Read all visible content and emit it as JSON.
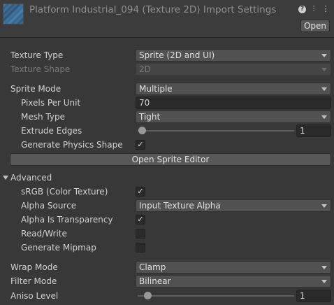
{
  "header": {
    "title": "Platform Industrial_094 (Texture 2D) Import Settings",
    "open_label": "Open",
    "help_icon": "?",
    "settings_icon": "⫶",
    "menu_icon": "⋮"
  },
  "settings": {
    "texture_type": {
      "label": "Texture Type",
      "value": "Sprite (2D and UI)"
    },
    "texture_shape": {
      "label": "Texture Shape",
      "value": "2D"
    },
    "sprite_mode": {
      "label": "Sprite Mode",
      "value": "Multiple"
    },
    "pixels_per_unit": {
      "label": "Pixels Per Unit",
      "value": "70"
    },
    "mesh_type": {
      "label": "Mesh Type",
      "value": "Tight"
    },
    "extrude_edges": {
      "label": "Extrude Edges",
      "value": "1",
      "fraction": 0.03
    },
    "generate_physics_shape": {
      "label": "Generate Physics Shape",
      "checked": true
    },
    "open_sprite_editor": "Open Sprite Editor"
  },
  "advanced": {
    "label": "Advanced",
    "srgb": {
      "label": "sRGB (Color Texture)",
      "checked": true
    },
    "alpha_source": {
      "label": "Alpha Source",
      "value": "Input Texture Alpha"
    },
    "alpha_is_transparency": {
      "label": "Alpha Is Transparency",
      "checked": true
    },
    "read_write": {
      "label": "Read/Write",
      "checked": false
    },
    "generate_mipmap": {
      "label": "Generate Mipmap",
      "checked": false
    }
  },
  "sampling": {
    "wrap_mode": {
      "label": "Wrap Mode",
      "value": "Clamp"
    },
    "filter_mode": {
      "label": "Filter Mode",
      "value": "Bilinear"
    },
    "aniso_level": {
      "label": "Aniso Level",
      "value": "1",
      "fraction": 0.0625
    }
  },
  "colors": {
    "background": "#383838",
    "field": "#515151",
    "button": "#585858",
    "text": "#d2d2d2",
    "disabled_text": "#7a7a7a",
    "title_text": "#8f8f8f"
  },
  "check_glyph": "✓"
}
